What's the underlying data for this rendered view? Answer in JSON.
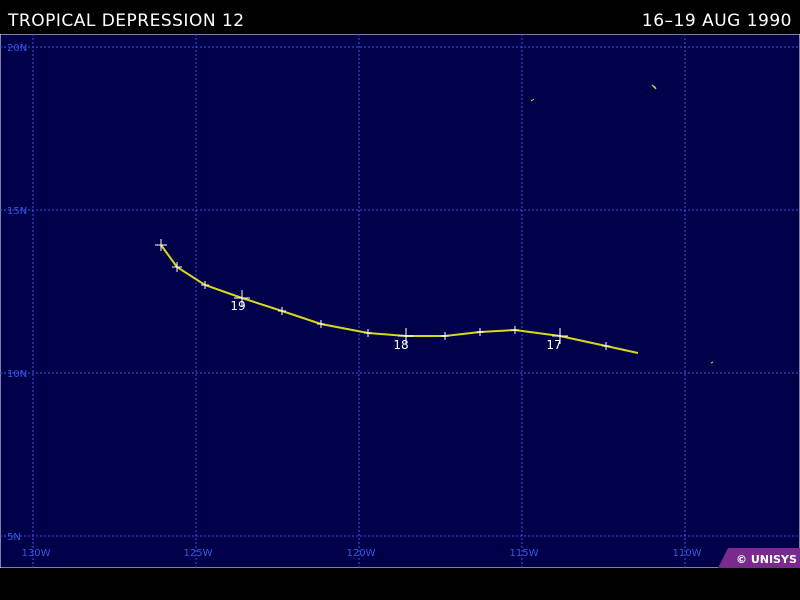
{
  "header": {
    "title": "TROPICAL DEPRESSION 12",
    "dates": "16–19 AUG 1990"
  },
  "map": {
    "background_color": "#00004a",
    "grid_color": "#3a56e8",
    "track_color": "#d8d81a",
    "lat_labels": [
      "20N",
      "15N",
      "10N",
      "5N"
    ],
    "lon_labels": [
      "130W",
      "125W",
      "120W",
      "115W",
      "110W"
    ],
    "day_labels": [
      "19",
      "18",
      "17"
    ],
    "badge": "© UNISYS",
    "badge_color": "#7a2a8c"
  }
}
